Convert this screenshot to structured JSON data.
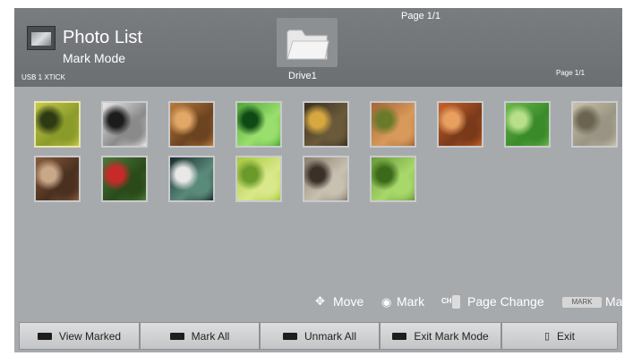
{
  "header": {
    "title": "Photo List",
    "mode": "Mark Mode",
    "device": "USB 1 XTICK",
    "folder_label": "Drive1",
    "page_top": "Page 1/1",
    "page_right": "Page 1/1"
  },
  "thumbnails": [
    {
      "id": "thumb-1",
      "colors": [
        "#c6c94a",
        "#2d3a14",
        "#8a9b2a"
      ],
      "selected": true
    },
    {
      "id": "thumb-2",
      "colors": [
        "#e8e8e8",
        "#1c1c1c",
        "#8a8a8a"
      ]
    },
    {
      "id": "thumb-3",
      "colors": [
        "#b97a3c",
        "#e0a766",
        "#6b4320"
      ]
    },
    {
      "id": "thumb-4",
      "colors": [
        "#4fa83a",
        "#0f4a14",
        "#9adf6e"
      ]
    },
    {
      "id": "thumb-5",
      "colors": [
        "#3a3020",
        "#d8a840",
        "#6a5a3a"
      ]
    },
    {
      "id": "thumb-6",
      "colors": [
        "#a8643a",
        "#6a7a2a",
        "#d89a5a"
      ]
    },
    {
      "id": "thumb-7",
      "colors": [
        "#c8602a",
        "#e8a060",
        "#7a3a1a"
      ]
    },
    {
      "id": "thumb-8",
      "colors": [
        "#6ab84a",
        "#b8e08a",
        "#3a8a2a"
      ]
    },
    {
      "id": "thumb-9",
      "colors": [
        "#c8c2a8",
        "#6a6450",
        "#9a9484"
      ]
    },
    {
      "id": "thumb-10",
      "colors": [
        "#8a5a3a",
        "#c8a888",
        "#4a3020"
      ]
    },
    {
      "id": "thumb-11",
      "colors": [
        "#4a7a3a",
        "#c82a2a",
        "#2a4a1a"
      ]
    },
    {
      "id": "thumb-12",
      "colors": [
        "#1a2a2a",
        "#e8e8e8",
        "#5a8a7a"
      ]
    },
    {
      "id": "thumb-13",
      "colors": [
        "#a8c83a",
        "#6a9a2a",
        "#d8e88a"
      ]
    },
    {
      "id": "thumb-14",
      "colors": [
        "#8a8070",
        "#3a3028",
        "#c8c0b0"
      ]
    },
    {
      "id": "thumb-15",
      "colors": [
        "#6a9a3a",
        "#3a6a1a",
        "#a8d86a"
      ]
    }
  ],
  "hints": {
    "move": "Move",
    "mark": "Mark",
    "ch_badge": "CH",
    "page_change": "Page Change",
    "mark_badge": "MARK",
    "mark2": "Mark"
  },
  "buttons": {
    "view_marked": "View Marked",
    "mark_all": "Mark All",
    "unmark_all": "Unmark All",
    "exit_mark_mode": "Exit Mark Mode",
    "exit": "Exit"
  }
}
